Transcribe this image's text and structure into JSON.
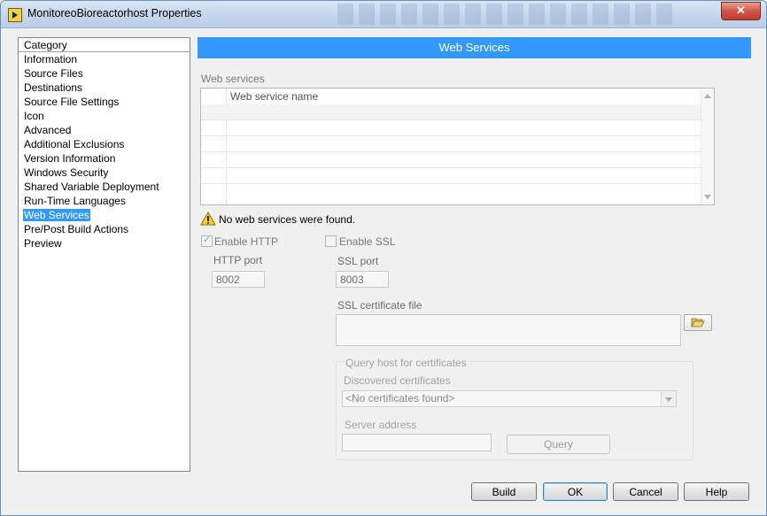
{
  "window": {
    "title": "MonitoreoBioreactorhost Properties",
    "close_label": "✕"
  },
  "category": {
    "header": "Category",
    "items": [
      {
        "label": "Information"
      },
      {
        "label": "Source Files"
      },
      {
        "label": "Destinations"
      },
      {
        "label": "Source File Settings"
      },
      {
        "label": "Icon"
      },
      {
        "label": "Advanced"
      },
      {
        "label": "Additional Exclusions"
      },
      {
        "label": "Version Information"
      },
      {
        "label": "Windows Security"
      },
      {
        "label": "Shared Variable Deployment"
      },
      {
        "label": "Run-Time Languages"
      },
      {
        "label": "Web Services",
        "selected": true
      },
      {
        "label": "Pre/Post Build Actions"
      },
      {
        "label": "Preview"
      }
    ]
  },
  "main": {
    "section_title": "Web Services",
    "web_services_label": "Web services",
    "table": {
      "column_header": "Web service name",
      "rows": []
    },
    "warning_text": "No web services were found.",
    "http": {
      "enable_label": "Enable HTTP",
      "enabled": true,
      "port_label": "HTTP port",
      "port_value": "8002"
    },
    "ssl": {
      "enable_label": "Enable SSL",
      "enabled": false,
      "port_label": "SSL port",
      "port_value": "8003",
      "cert_file_label": "SSL certificate file",
      "cert_file_value": ""
    },
    "query_group": {
      "title": "Query host for certificates",
      "discovered_label": "Discovered certificates",
      "discovered_value": "<No certificates found>",
      "server_address_label": "Server address",
      "server_address_value": "",
      "query_label": "Query"
    }
  },
  "buttons": {
    "build": "Build",
    "ok": "OK",
    "cancel": "Cancel",
    "help": "Help"
  },
  "colors": {
    "accent": "#3399ff",
    "warning": "#f6d42c"
  }
}
